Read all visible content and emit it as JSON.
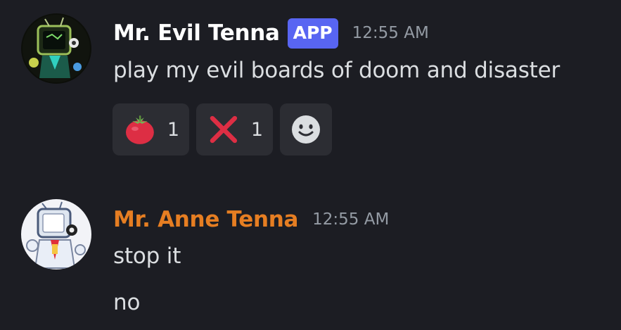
{
  "messages": [
    {
      "username": "Mr. Evil Tenna",
      "username_color": "#ffffff",
      "badge": "APP",
      "timestamp": "12:55 AM",
      "lines": [
        "play my evil boards of doom and disaster"
      ],
      "reactions": [
        {
          "emoji": "tomato-icon",
          "count": "1"
        },
        {
          "emoji": "cross-mark-icon",
          "count": "1"
        }
      ],
      "add_reaction_icon": "smiley-face-icon"
    },
    {
      "username": "Mr. Anne Tenna",
      "username_color": "#e67e22",
      "timestamp": "12:55 AM",
      "lines": [
        "stop it",
        "no"
      ]
    }
  ],
  "colors": {
    "background": "#1c1d23",
    "badge": "#5865f2",
    "timestamp": "#949ba4",
    "text": "#dbdee1",
    "reaction_bg": "#2c2d33"
  }
}
